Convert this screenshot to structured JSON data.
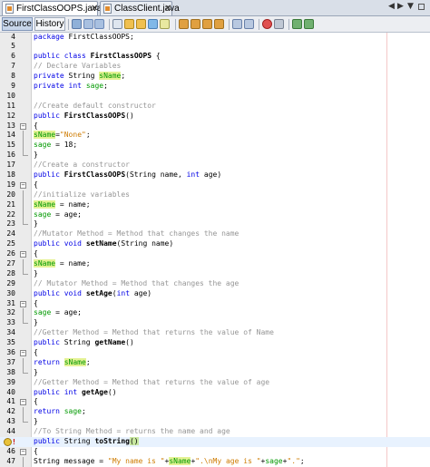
{
  "tabs": [
    {
      "label": "FirstClassOOPS.java",
      "active": true
    },
    {
      "label": "ClassClient.java",
      "active": false
    }
  ],
  "toolbar": {
    "source_label": "Source",
    "history_label": "History"
  },
  "editor": {
    "highlighted_line": 48,
    "lines": [
      {
        "n": "4",
        "t": "package FirstClassOOPS;"
      },
      {
        "n": "5",
        "t": ""
      },
      {
        "n": "6",
        "t": "public class FirstClassOOPS {"
      },
      {
        "n": "7",
        "t": "// Declare Variables"
      },
      {
        "n": "8",
        "t": "private String sName;"
      },
      {
        "n": "9",
        "t": "private int sage;"
      },
      {
        "n": "10",
        "t": ""
      },
      {
        "n": "11",
        "t": "//Create default constructor"
      },
      {
        "n": "12",
        "t": "public FirstClassOOPS()"
      },
      {
        "n": "13",
        "t": "{"
      },
      {
        "n": "14",
        "t": "sName=\"None\";"
      },
      {
        "n": "15",
        "t": "sage = 18;"
      },
      {
        "n": "16",
        "t": "}"
      },
      {
        "n": "17",
        "t": "//Create a constructor"
      },
      {
        "n": "18",
        "t": "public FirstClassOOPS(String name, int age)"
      },
      {
        "n": "19",
        "t": "{"
      },
      {
        "n": "20",
        "t": "//initialize variables"
      },
      {
        "n": "21",
        "t": "sName = name;"
      },
      {
        "n": "22",
        "t": "sage = age;"
      },
      {
        "n": "23",
        "t": "}"
      },
      {
        "n": "24",
        "t": "//Mutator Method = Method that changes the name"
      },
      {
        "n": "25",
        "t": "public void setName(String name)"
      },
      {
        "n": "26",
        "t": "{"
      },
      {
        "n": "27",
        "t": "sName = name;"
      },
      {
        "n": "28",
        "t": "}"
      },
      {
        "n": "29",
        "t": "// Mutator Method = Method that changes the age"
      },
      {
        "n": "30",
        "t": "public void setAge(int age)"
      },
      {
        "n": "31",
        "t": "{"
      },
      {
        "n": "32",
        "t": "sage = age;"
      },
      {
        "n": "33",
        "t": "}"
      },
      {
        "n": "34",
        "t": "//Getter Method = Method that returns the value of Name"
      },
      {
        "n": "35",
        "t": "public String getName()"
      },
      {
        "n": "36",
        "t": "{"
      },
      {
        "n": "37",
        "t": "return sName;"
      },
      {
        "n": "38",
        "t": "}"
      },
      {
        "n": "39",
        "t": "//Getter Method = Method that returns the value of age"
      },
      {
        "n": "40",
        "t": "public int getAge()"
      },
      {
        "n": "41",
        "t": "{"
      },
      {
        "n": "42",
        "t": "return sage;"
      },
      {
        "n": "43",
        "t": "}"
      },
      {
        "n": "44",
        "t": "//To String Method = returns the name and age"
      },
      {
        "n": "45",
        "t": "public String toString()"
      },
      {
        "n": "46",
        "t": "{"
      },
      {
        "n": "47",
        "t": "String message = \"My name is \"+sName+\".\\nMy age is \"+sage+\".\";"
      }
    ]
  },
  "colors": {
    "keyword": "#0000e6",
    "comment": "#969696",
    "string": "#ce7b00",
    "field": "#009900",
    "occurrence_highlight": "#e4f294",
    "current_line": "#e8f2fe"
  },
  "icons": [
    "java-file-icon",
    "close-icon",
    "tab-scroll-left-icon",
    "tab-scroll-right-icon",
    "tab-list-icon",
    "maximize-icon",
    "back-icon",
    "forward-icon",
    "find-icon",
    "find-previous-icon",
    "find-next-icon",
    "toggle-highlight-icon",
    "toggle-rectangular-selection-icon",
    "shift-left-icon",
    "shift-right-icon",
    "start-macro-icon",
    "stop-macro-icon",
    "comment-icon",
    "uncomment-icon",
    "fold-collapse-icon",
    "warning-bulb-icon"
  ]
}
